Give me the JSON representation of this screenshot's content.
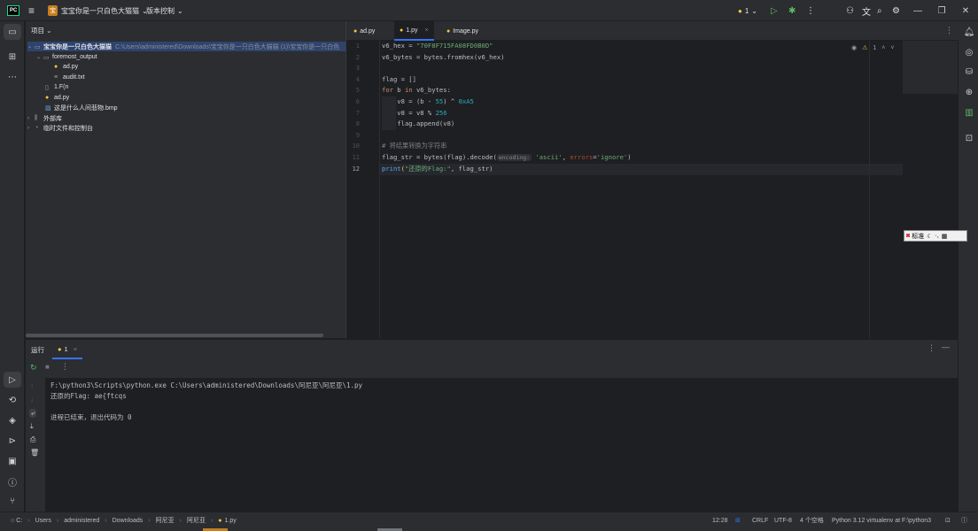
{
  "titlebar": {
    "logo": "PC",
    "project_badge": "宝",
    "project_name": "宝宝你是一只白色大猫猫",
    "vcs_label": "版本控制",
    "run_config": "1",
    "icons": [
      "hamburger-icon",
      "chevron-down-icon",
      "python-icon",
      "run-icon",
      "debug-icon",
      "more-icon",
      "user-icon",
      "translate-icon",
      "search-icon",
      "settings-icon"
    ]
  },
  "project_panel": {
    "header": "项目",
    "tree": [
      {
        "label": "宝宝你是一只白色大猫猫",
        "path": "C:\\Users\\administered\\Downloads\\宝宝你是一只白色大猫猫 (1)\\宝宝你是一只白色",
        "icon": "folder"
      },
      {
        "label": "foremost_output",
        "icon": "folder"
      },
      {
        "label": "ad.py",
        "icon": "python"
      },
      {
        "label": "audit.txt",
        "icon": "text"
      },
      {
        "label": "1.F(n",
        "icon": "file"
      },
      {
        "label": "ad.py",
        "icon": "python"
      },
      {
        "label": "这是什么人间悲物.bmp",
        "icon": "image"
      },
      {
        "label": "外部库",
        "icon": "library"
      },
      {
        "label": "临时文件和控制台",
        "icon": "scratch"
      }
    ]
  },
  "editor": {
    "tabs": [
      {
        "label": "ad.py"
      },
      {
        "label": "1.py",
        "close": "×"
      },
      {
        "label": "Image.py"
      }
    ],
    "warnings": "1",
    "line_numbers": [
      "1",
      "2",
      "3",
      "4",
      "5",
      "6",
      "7",
      "8",
      "9",
      "10",
      "11",
      "12"
    ],
    "lines": {
      "l1a": "v6_hex = ",
      "l1b": "\"70F8F715FA08FD0B0D\"",
      "l2": "v6_bytes = bytes.fromhex(v6_hex)",
      "l4": "flag = []",
      "l5a": "for",
      "l5b": " b ",
      "l5c": "in",
      "l5d": " v6_bytes:",
      "l6a": "    v8 = (b - ",
      "l6b": "55",
      "l6c": ") ^ ",
      "l6d": "0xA5",
      "l7a": "    v8 = v8 % ",
      "l7b": "256",
      "l8": "    flag.append(v8)",
      "l10": "# 将结果转换为字符串",
      "l11a": "flag_str = bytes(flag).decode(",
      "l11hint": "encoding:",
      "l11b": " 'ascii'",
      "l11c": ", ",
      "l11d": "errors",
      "l11e": "=",
      "l11f": "'ignore'",
      "l11g": ")",
      "l12a": "print",
      "l12b": "(",
      "l12c": "\"还原的Flag:\"",
      "l12d": ", flag_str)"
    }
  },
  "run_panel": {
    "header": "运行",
    "tab_label": "1",
    "tab_close": "×",
    "output": [
      "F:\\python3\\Scripts\\python.exe C:\\Users\\administered\\Downloads\\阿尼亚\\阿尼亚\\1.py",
      "还原的Flag: ae{ftcqs",
      "",
      "进程已结束，退出代码为 0"
    ]
  },
  "ime": {
    "label": "标准"
  },
  "statusbar": {
    "breadcrumbs": [
      "C:",
      "Users",
      "administered",
      "Downloads",
      "阿尼亚",
      "阿尼亚",
      "1.py"
    ],
    "position": "12:28",
    "line_ending": "CRLF",
    "encoding": "UTF-8",
    "indent": "4 个空格",
    "interpreter": "Python 3.12 virtualenv at F:\\python3"
  }
}
